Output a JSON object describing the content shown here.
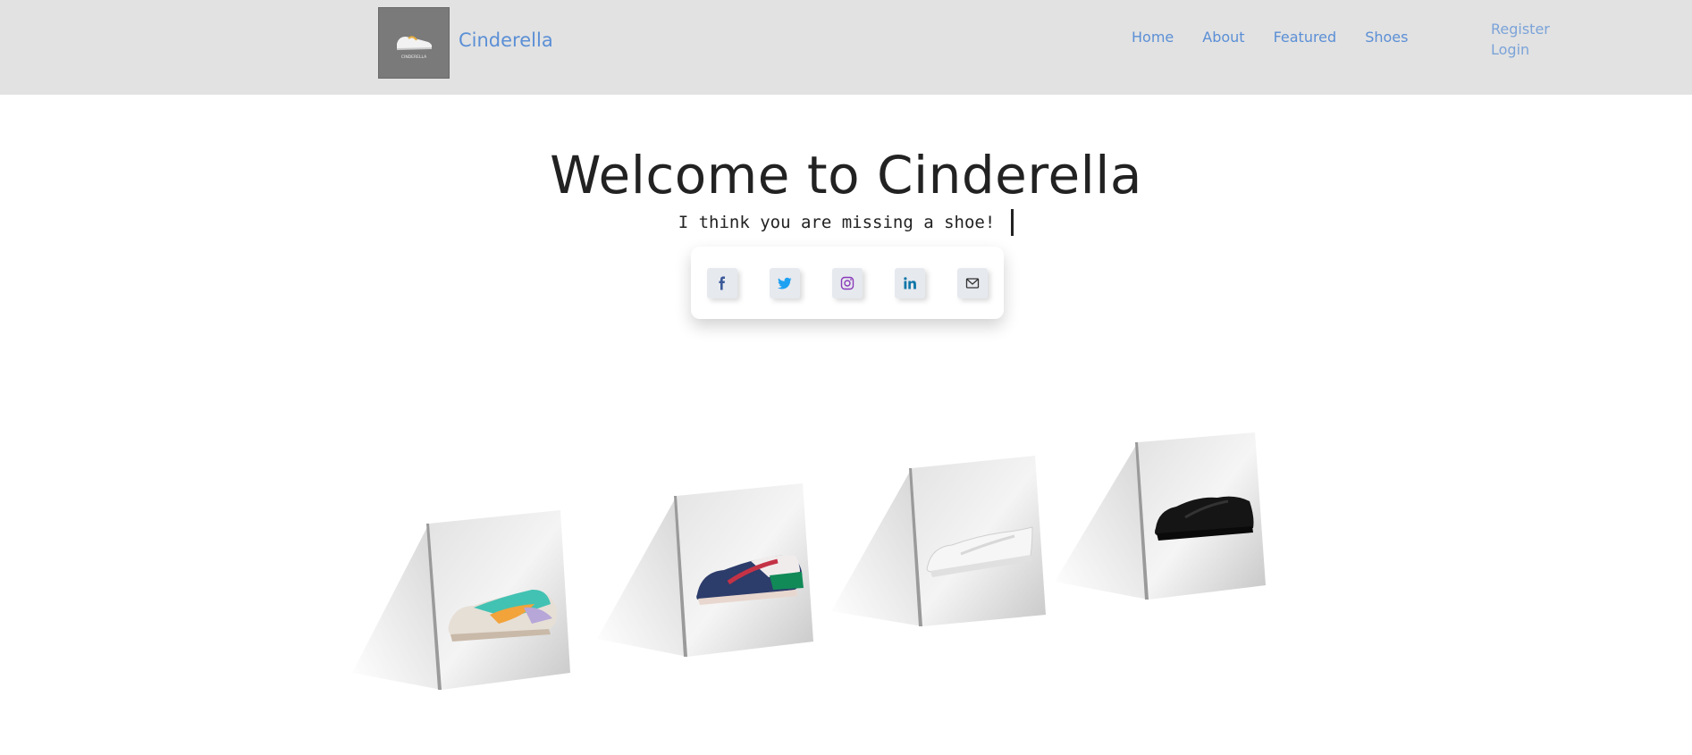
{
  "nav": {
    "brand": "Cinderella",
    "logo_text": "CINDERELLA",
    "links": [
      "Home",
      "About",
      "Featured",
      "Shoes"
    ],
    "register": "Register",
    "login": "Login"
  },
  "hero": {
    "title": "Welcome to Cinderella",
    "subtitle": "I think you are missing a shoe!"
  },
  "social": [
    {
      "icon": "facebook-icon",
      "color": "#3b5998"
    },
    {
      "icon": "twitter-icon",
      "color": "#1da1f2"
    },
    {
      "icon": "instagram-icon",
      "color": "#8a3ab9"
    },
    {
      "icon": "linkedin-icon",
      "color": "#0e76a8"
    },
    {
      "icon": "mail-icon",
      "color": "#333333"
    }
  ],
  "colors": {
    "navbar_bg": "#e2e2e2",
    "link": "#5b8fd6",
    "auth_link": "#7ba3d9"
  },
  "shoes": [
    {
      "name": "shoe-card-pastel",
      "style": "pastel"
    },
    {
      "name": "shoe-card-navy-green",
      "style": "navy"
    },
    {
      "name": "shoe-card-white",
      "style": "white"
    },
    {
      "name": "shoe-card-black",
      "style": "black"
    }
  ]
}
